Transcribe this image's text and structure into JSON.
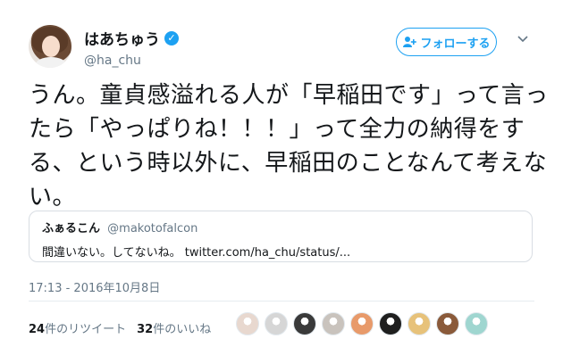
{
  "user": {
    "display_name": "はあちゅう",
    "handle": "@ha_chu"
  },
  "actions": {
    "follow_label": "フォローする"
  },
  "tweet": {
    "text": "うん。童貞感溢れる人が「早稲田です」って言ったら「やっぱりね！！！」って全力の納得をする、という時以外に、早稲田のことなんて考えない。",
    "timestamp": "17:13 - 2016年10月8日"
  },
  "quote": {
    "name": "ふぁるこん",
    "handle": "@makotofalcon",
    "text": "間違いない。してないね。 twitter.com/ha_chu/status/..."
  },
  "stats": {
    "retweets_count": "24",
    "retweets_label": "件のリツイート",
    "likes_count": "32",
    "likes_label": "件のいいね"
  },
  "likers": [
    {
      "avatar": "liker-1",
      "color": "#e8d8cf"
    },
    {
      "avatar": "liker-2",
      "color": "#d6d6d6"
    },
    {
      "avatar": "liker-3",
      "color": "#3a3a3a"
    },
    {
      "avatar": "liker-4",
      "color": "#c9c3bd"
    },
    {
      "avatar": "liker-5",
      "color": "#e89a6a"
    },
    {
      "avatar": "liker-6",
      "color": "#1f1f1f"
    },
    {
      "avatar": "liker-7",
      "color": "#e7c27a"
    },
    {
      "avatar": "liker-8",
      "color": "#8a5a3a"
    },
    {
      "avatar": "liker-9",
      "color": "#9fd6d0"
    }
  ],
  "colors": {
    "accent": "#1da1f2",
    "secondary_text": "#657786",
    "border": "#d8dde3"
  }
}
